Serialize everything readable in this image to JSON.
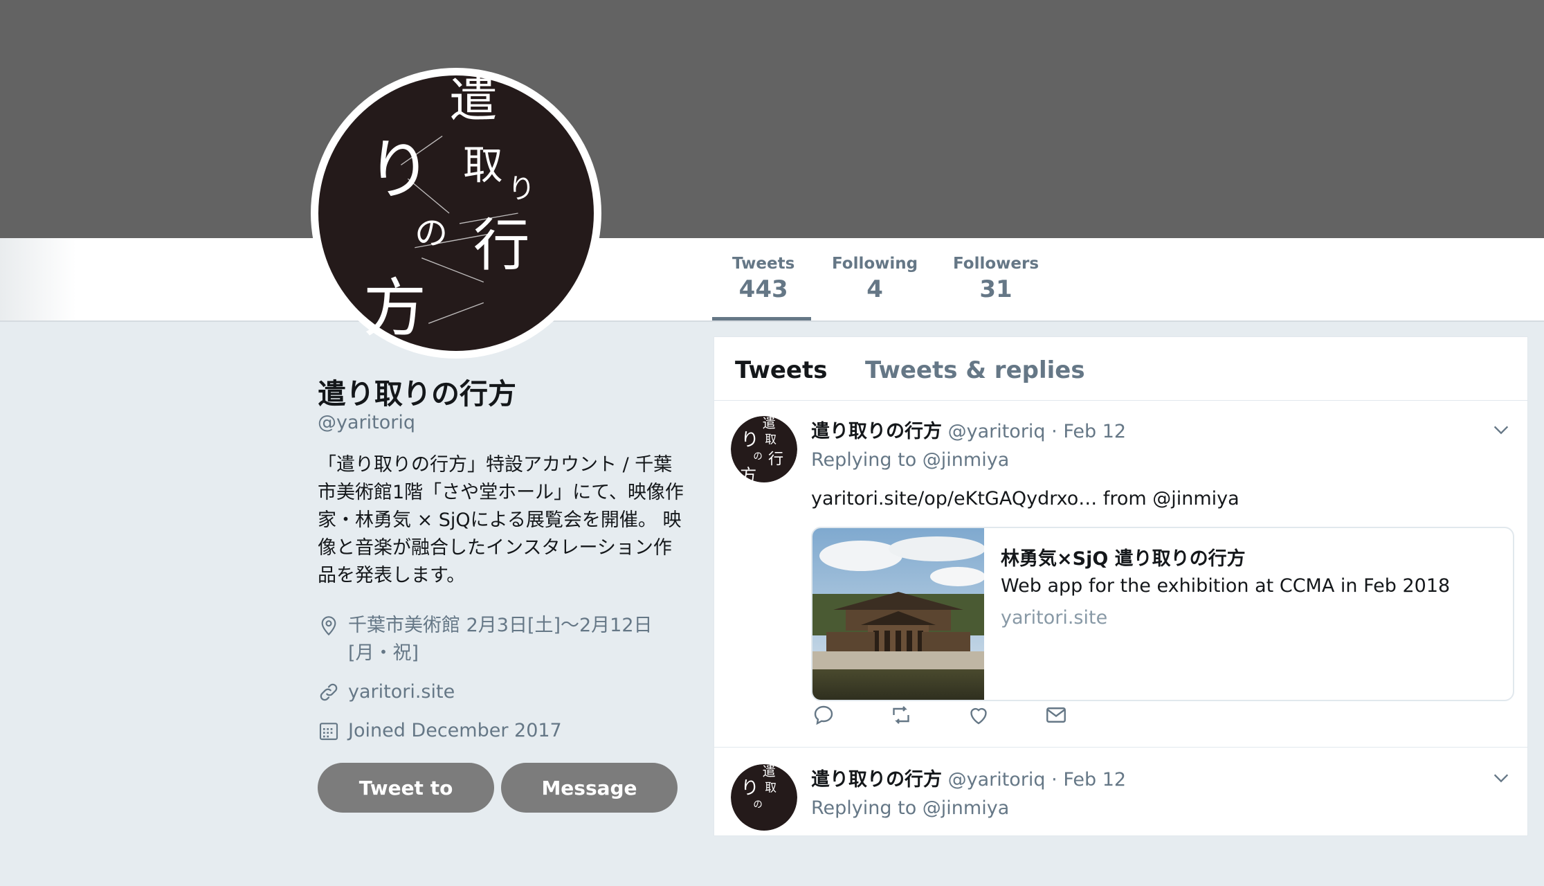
{
  "colors": {
    "banner": "#636363",
    "background": "#e6ecf0",
    "text": "#14171a",
    "muted": "#657786",
    "button": "#7c7c7c",
    "avatar_bg": "#241a1a"
  },
  "profile": {
    "name": "遣り取りの行方",
    "handle": "@yaritoriq",
    "bio": "「遣り取りの行方」特設アカウント / 千葉市美術館1階「さや堂ホール」にて、映像作家・林勇気 × SjQによる展覧会を開催。 映像と音楽が融合したインスタレーション作品を発表します。",
    "location": "千葉市美術館 2月3日[土]〜2月12日[月・祝]",
    "website": "yaritori.site",
    "joined": "Joined December 2017",
    "avatar_glyphs": [
      "遣",
      "り",
      "取",
      "り",
      "の",
      "行",
      "方"
    ],
    "buttons": {
      "tweet_to": "Tweet to",
      "message": "Message"
    }
  },
  "stats": [
    {
      "label": "Tweets",
      "value": "443"
    },
    {
      "label": "Following",
      "value": "4"
    },
    {
      "label": "Followers",
      "value": "31"
    }
  ],
  "timeline": {
    "tabs": [
      "Tweets",
      "Tweets & replies"
    ],
    "tweets": [
      {
        "name": "遣り取りの行方",
        "handle": "@yaritoriq",
        "date": "· Feb 12",
        "replying_to": "Replying to @jinmiya",
        "text": "yaritori.site/op/eKtGAQydrxo… from @jinmiya",
        "card": {
          "title": "林勇気×SjQ 遣り取りの行方",
          "description": "Web app for the exhibition at CCMA in Feb 2018",
          "domain": "yaritori.site"
        },
        "actions": [
          "reply-icon",
          "retweet-icon",
          "like-icon",
          "direct-message-icon"
        ]
      },
      {
        "name": "遣り取りの行方",
        "handle": "@yaritoriq",
        "date": "· Feb 12",
        "replying_to": "Replying to @jinmiya"
      }
    ]
  }
}
